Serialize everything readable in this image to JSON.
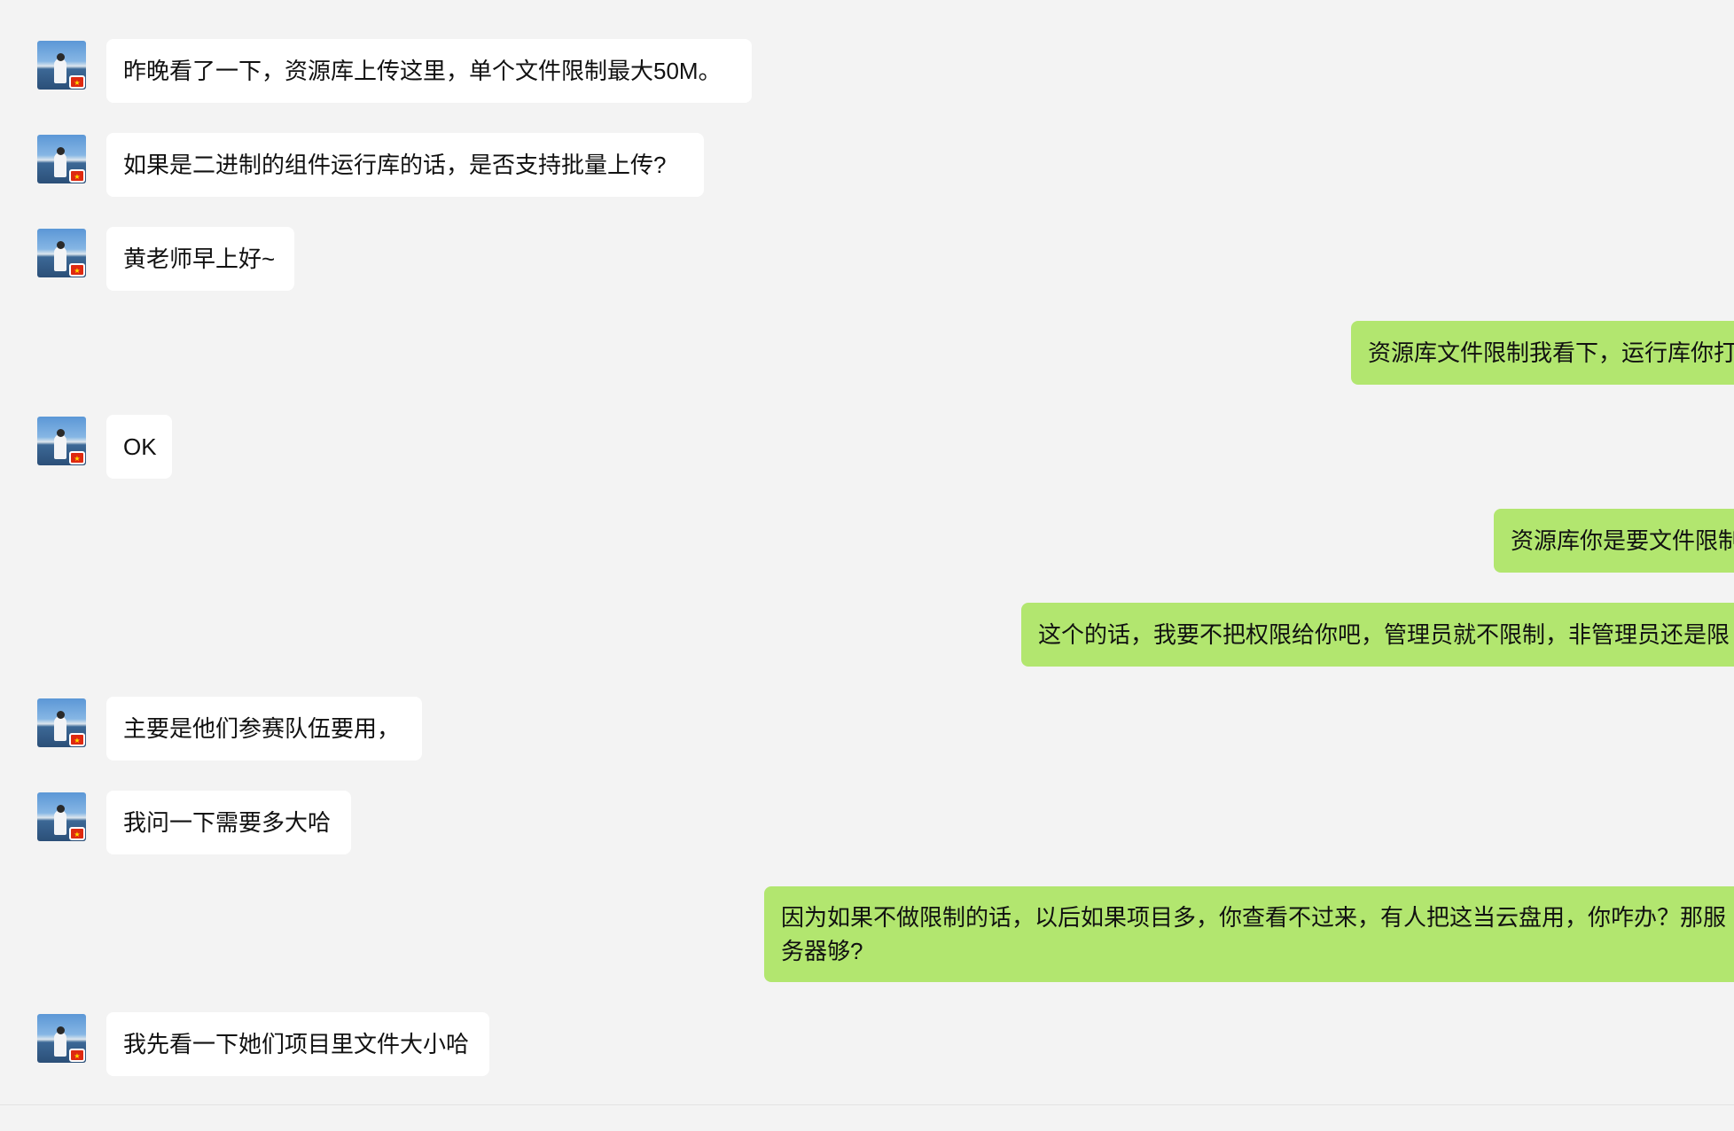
{
  "chat": {
    "messages": [
      {
        "side": "in",
        "text": "昨晚看了一下，资源库上传这里，单个文件限制最大50M。"
      },
      {
        "side": "in",
        "text": "如果是二进制的组件运行库的话，是否支持批量上传?"
      },
      {
        "side": "in",
        "text": "黄老师早上好~"
      },
      {
        "side": "out",
        "text": "资源库文件限制我看下，运行库你打"
      },
      {
        "side": "in",
        "text": "OK"
      },
      {
        "side": "out",
        "text": "资源库你是要文件限制"
      },
      {
        "side": "out",
        "text": "这个的话，我要不把权限给你吧，管理员就不限制，非管理员还是限"
      },
      {
        "side": "in",
        "text": "主要是他们参赛队伍要用，"
      },
      {
        "side": "in",
        "text": "我问一下需要多大哈"
      },
      {
        "side": "out",
        "text": "因为如果不做限制的话，以后如果项目多，你查看不过来，有人把这当云盘用，你咋办？那服务器够?"
      },
      {
        "side": "in",
        "text": "我先看一下她们项目里文件大小哈"
      }
    ]
  },
  "avatar": {
    "icon": "user-avatar-icon",
    "badge_icon": "china-flag-icon",
    "badge_glyph": "★"
  },
  "colors": {
    "background": "#f3f3f3",
    "incoming_bubble": "#ffffff",
    "outgoing_bubble": "#b2e66f",
    "text": "#111111"
  }
}
